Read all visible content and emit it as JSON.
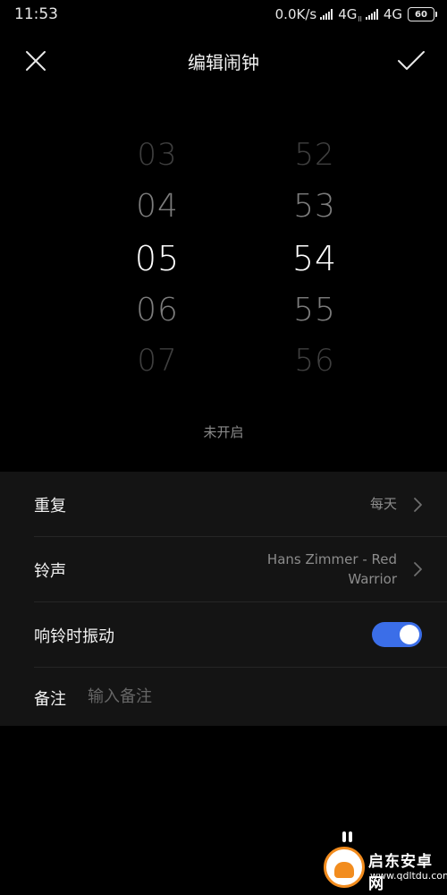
{
  "status_bar": {
    "time": "11:53",
    "speed": "0.0K/s",
    "network1": "4G",
    "network1_sub": "ll",
    "network2": "4G",
    "battery": "60"
  },
  "header": {
    "title": "编辑闹钟",
    "close_icon": "close-icon",
    "confirm_icon": "checkmark-icon"
  },
  "picker": {
    "hours": [
      "03",
      "04",
      "05",
      "06",
      "07"
    ],
    "minutes": [
      "52",
      "53",
      "54",
      "55",
      "56"
    ],
    "selected_hour": "05",
    "selected_minute": "54"
  },
  "alarm_status": "未开启",
  "settings": {
    "repeat": {
      "label": "重复",
      "value": "每天"
    },
    "ringtone": {
      "label": "铃声",
      "value_line1": "Hans Zimmer - Red",
      "value_line2": "Warrior"
    },
    "vibrate": {
      "label": "响铃时振动",
      "enabled": true
    },
    "note": {
      "label": "备注",
      "placeholder": "输入备注",
      "value": ""
    }
  },
  "watermark": {
    "text": "启东安卓网",
    "url": "www.qdltdu.com"
  },
  "colors": {
    "background": "#000000",
    "panel": "#141414",
    "accent": "#3b6ee8",
    "watermark_orange": "#f28c1e"
  }
}
